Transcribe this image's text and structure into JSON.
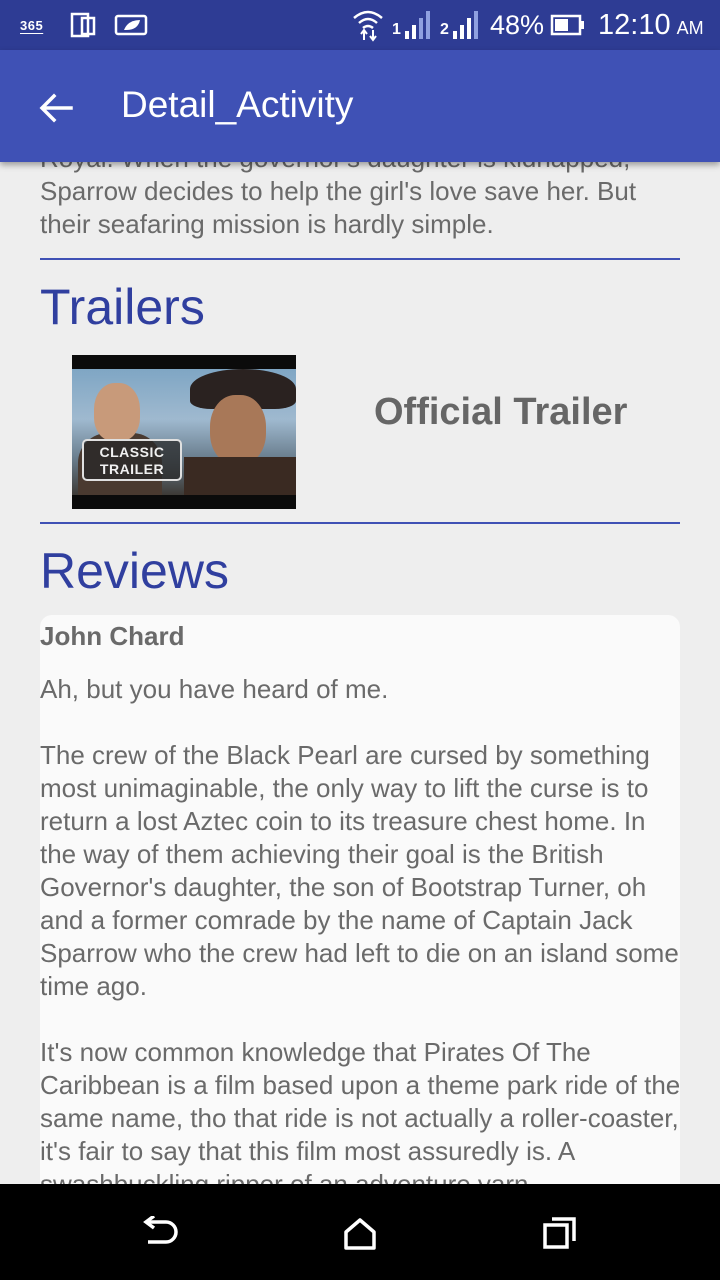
{
  "status_bar": {
    "volte_label": "365",
    "battery_percent": "48%",
    "time": "12:10",
    "ampm": "AM",
    "signal_1_label": "1",
    "signal_2_label": "2"
  },
  "app_bar": {
    "title": "Detail_Activity",
    "back_icon": "arrow-back-icon"
  },
  "overview": {
    "text": "Royal. When the governor's daughter is kidnapped, Sparrow decides to help the girl's love save her. But their seafaring mission is hardly simple."
  },
  "trailers": {
    "heading": "Trailers",
    "items": [
      {
        "name": "Official Trailer",
        "thumbnail_badge": "CLASSIC TRAILER"
      }
    ]
  },
  "reviews": {
    "heading": "Reviews",
    "items": [
      {
        "author": "John Chard",
        "paragraphs": [
          "Ah, but you have heard of me.",
          "The crew of the Black Pearl are cursed by something most unimaginable, the only way to lift the curse is to return a lost Aztec coin to its treasure chest home. In the way of them achieving their goal is the British Governor's daughter, the son of Bootstrap Turner, oh and a former comrade by the name of Captain Jack Sparrow who the crew had left to die on an island some time ago.",
          "It's now common knowledge that Pirates Of The Caribbean is a film based upon a theme park ride of the same name, tho that ride is not actually a roller-coaster, it's fair to say that this film most assuredly is. A swashbuckling ripper of an adventure yarn"
        ]
      }
    ]
  },
  "nav_bar": {
    "back_icon": "nav-back-icon",
    "home_icon": "nav-home-icon",
    "recent_icon": "nav-recent-apps-icon"
  },
  "colors": {
    "status_bar": "#2e3c94",
    "app_bar": "#3f51b5",
    "accent_text": "#303f9f",
    "body_text": "#6a6a6a",
    "background": "#eeeeee"
  }
}
